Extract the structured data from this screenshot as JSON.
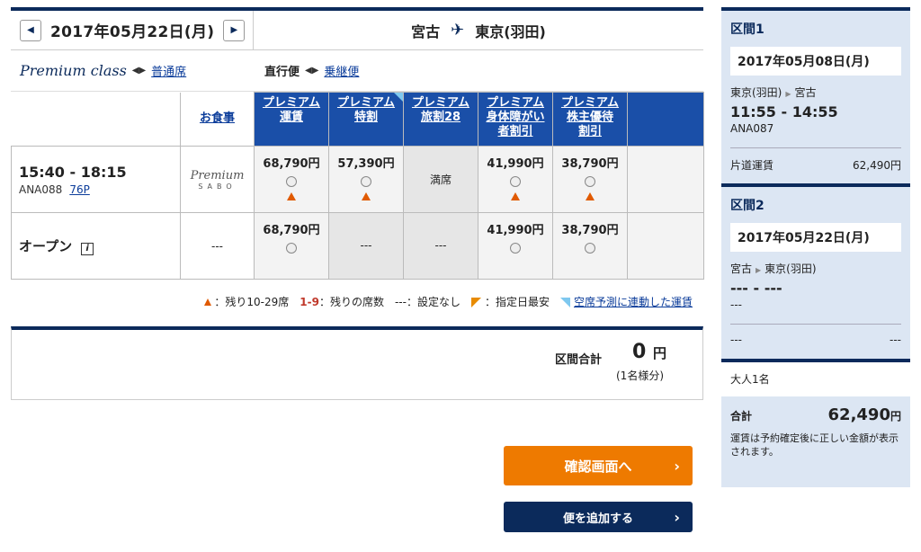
{
  "header": {
    "date": "2017年05月22日(月)",
    "origin": "宮古",
    "destination": "東京(羽田)"
  },
  "classbar": {
    "premium_label": "Premium class",
    "normal_link": "普通席",
    "direct_label": "直行便",
    "transit_link": "乗継便"
  },
  "table": {
    "meal_header": "お食事",
    "fare_headers": [
      {
        "line1": "プレミアム",
        "line2": "運賃",
        "line3": ""
      },
      {
        "line1": "プレミアム",
        "line2": "特割",
        "line3": ""
      },
      {
        "line1": "プレミアム",
        "line2": "旅割28",
        "line3": ""
      },
      {
        "line1": "プレミアム",
        "line2": "身体障がい",
        "line3": "者割引"
      },
      {
        "line1": "プレミアム",
        "line2": "株主優待",
        "line3": "割引"
      }
    ],
    "flight": {
      "time": "15:40 - 18:15",
      "number": "ANA088",
      "aircraft": "76P",
      "sabo_line1": "Premium",
      "sabo_line2": "SABO",
      "fares": [
        "68,790円",
        "57,390円",
        "満席",
        "41,990円",
        "38,790円"
      ]
    },
    "open": {
      "label": "オープン",
      "info": "i",
      "meal": "---",
      "fares": [
        "68,790円",
        "---",
        "---",
        "41,990円",
        "38,790円"
      ]
    }
  },
  "legend": {
    "few_seats": "：残り10-29席",
    "remaining_key": "1-9",
    "remaining": "：残りの席数",
    "none_key": "---",
    "none": "：設定なし",
    "cheapest": "：指定日最安",
    "linked_link": "空席予測に連動した運賃"
  },
  "total": {
    "label": "区間合計",
    "amount": "0",
    "unit": "円",
    "sub": "(1名様分)"
  },
  "buttons": {
    "confirm": "確認画面へ",
    "add_flight": "便を追加する"
  },
  "sidebar": {
    "seg1": {
      "title": "区間1",
      "date": "2017年05月08日(月)",
      "from": "東京(羽田)",
      "to": "宮古",
      "time": "11:55 - 14:55",
      "flight": "ANA087",
      "fare_label": "片道運賃",
      "fare_value": "62,490円"
    },
    "seg2": {
      "title": "区間2",
      "date": "2017年05月22日(月)",
      "from": "宮古",
      "to": "東京(羽田)",
      "time": "--- - ---",
      "flight": "---",
      "fare_label": "---",
      "fare_value": "---"
    },
    "pax": "大人1名",
    "total_label": "合計",
    "total_value": "62,490",
    "total_unit": "円",
    "note": "運賃は予約確定後に正しい金額が表示されます。"
  },
  "colors": {
    "navy": "#0b2a5b",
    "header_blue": "#1a4fa8",
    "orange": "#ee7a00",
    "sidebar_bg": "#dce6f3"
  }
}
